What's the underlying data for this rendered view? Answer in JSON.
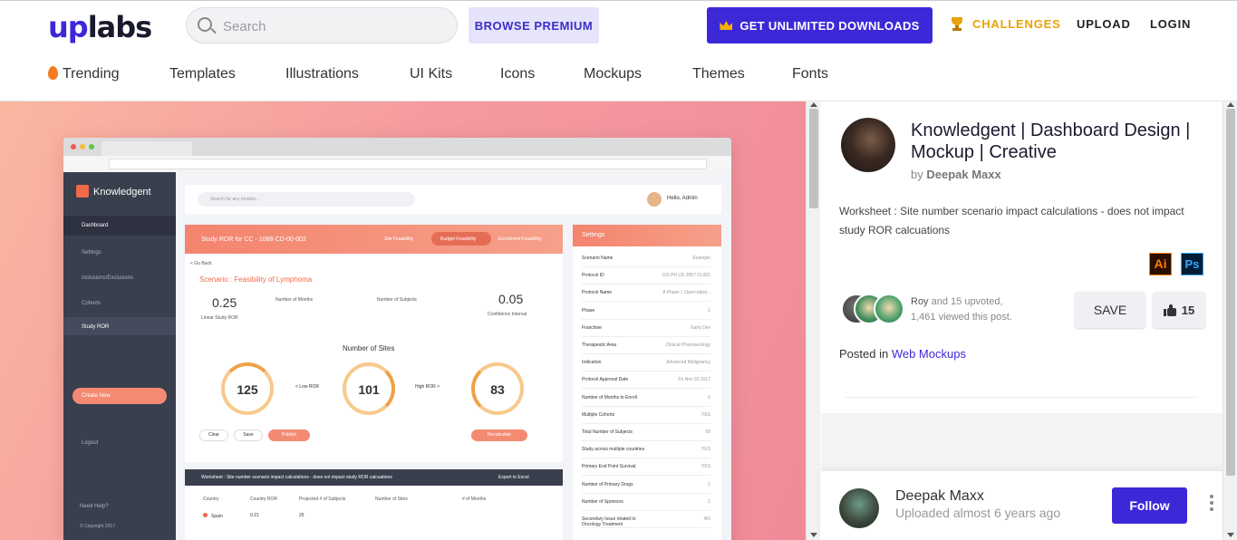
{
  "header": {
    "logo_up": "up",
    "logo_labs": "labs",
    "search_placeholder": "Search",
    "browse_premium": "BROWSE PREMIUM",
    "unlimited": "GET UNLIMITED DOWNLOADS",
    "challenges": "CHALLENGES",
    "upload": "UPLOAD",
    "login": "LOGIN"
  },
  "categories": [
    {
      "label": "Trending",
      "icon": "flame-icon"
    },
    {
      "label": "Templates"
    },
    {
      "label": "Illustrations"
    },
    {
      "label": "UI Kits"
    },
    {
      "label": "Icons"
    },
    {
      "label": "Mockups"
    },
    {
      "label": "Themes"
    },
    {
      "label": "Fonts"
    }
  ],
  "preview": {
    "app_name": "Knowledgent",
    "search_hint": "Search for any models...",
    "admin": "Hello, Admin",
    "menu": [
      "Dashboard",
      "Settings",
      "Inclusions/Exclusions",
      "Cohorts",
      "Study ROR"
    ],
    "create_new": "Create New",
    "logout": "Logout",
    "need_help": "Need Help?",
    "copyright": "© Copyright 2017",
    "study_title": "Study ROR for CC - 1088-CD-00-002",
    "tabs": [
      "Site Feasibility",
      "Budget Feasibility",
      "Enrollment Feasibility"
    ],
    "go_back": "< Go Back",
    "scenario": "Scenario : Feasibility of Lymphoma",
    "ror_value": "0.25",
    "ror_label": "Linear Study ROR",
    "months_label": "Number of Months",
    "subjects_label": "Number of Subjects",
    "confidence_value": "0.05",
    "confidence_label": "Confidence Interval",
    "sites_heading": "Number of Sites",
    "gauges": [
      {
        "value": "125"
      },
      {
        "value": "101"
      },
      {
        "value": "83"
      }
    ],
    "low_ror": "< Low ROR",
    "high_ror": "High ROR >",
    "clear": "Clear",
    "save": "Save",
    "publish": "Publish",
    "recalculate": "Recalculate",
    "settings_title": "Settings",
    "settings_rows": [
      {
        "k": "Scenario Name",
        "v": "Example"
      },
      {
        "k": "Protocol ID",
        "v": "103 PH US 2007 CL001"
      },
      {
        "k": "Protocol Name",
        "v": "A Phase I, Open-label..."
      },
      {
        "k": "Phase",
        "v": "1"
      },
      {
        "k": "Franchise",
        "v": "Early Dev"
      },
      {
        "k": "Therapeutic Area",
        "v": "Clinical Pharmacology"
      },
      {
        "k": "Indication",
        "v": "Advanced Malignancy"
      },
      {
        "k": "Protocol Approval Date",
        "v": "Fri Nov 03 2017"
      },
      {
        "k": "Number of Months to Enroll",
        "v": "6"
      },
      {
        "k": "Multiple Cohorts",
        "v": "YES"
      },
      {
        "k": "Total Number of Subjects",
        "v": "50"
      },
      {
        "k": "Study across multiple countries",
        "v": "YES"
      },
      {
        "k": "Primary End Point Survival",
        "v": "YES"
      },
      {
        "k": "Number of Primary Drugs",
        "v": "1"
      },
      {
        "k": "Number of Sponsors",
        "v": "1"
      },
      {
        "k": "Secondary Issue related to Oncology Treatment",
        "v": "NO"
      }
    ],
    "worksheet_title": "Worksheet : Site number scenario impact calculations - does not impact study ROR calcuations",
    "export": "Export to Excel",
    "table_headers": [
      "Country",
      "Country ROR",
      "Projected # of Subjects",
      "Number of Sites",
      "# of Months"
    ],
    "table_row": [
      "Spain",
      "0.21",
      "25"
    ]
  },
  "panel": {
    "title": "Knowledgent | Dashboard Design | Mockup | Creative",
    "by_prefix": "by",
    "author": "Deepak Maxx",
    "description": "Worksheet : Site number scenario impact calculations - does not impact study ROR calcuations",
    "tool_ai": "Ai",
    "tool_ps": "Ps",
    "upvoter": "Roy",
    "upvote_rest": "and 15 upvoted,",
    "views": "1,461 viewed this post.",
    "save": "SAVE",
    "likes": "15",
    "posted_in": "Posted in",
    "category": "Web Mockups"
  },
  "footer": {
    "name": "Deepak Maxx",
    "uploaded": "Uploaded almost 6 years ago",
    "follow": "Follow"
  },
  "colors": {
    "brand": "#3d28d8",
    "challenges": "#e8a30a",
    "accent_coral": "#f4846e"
  }
}
